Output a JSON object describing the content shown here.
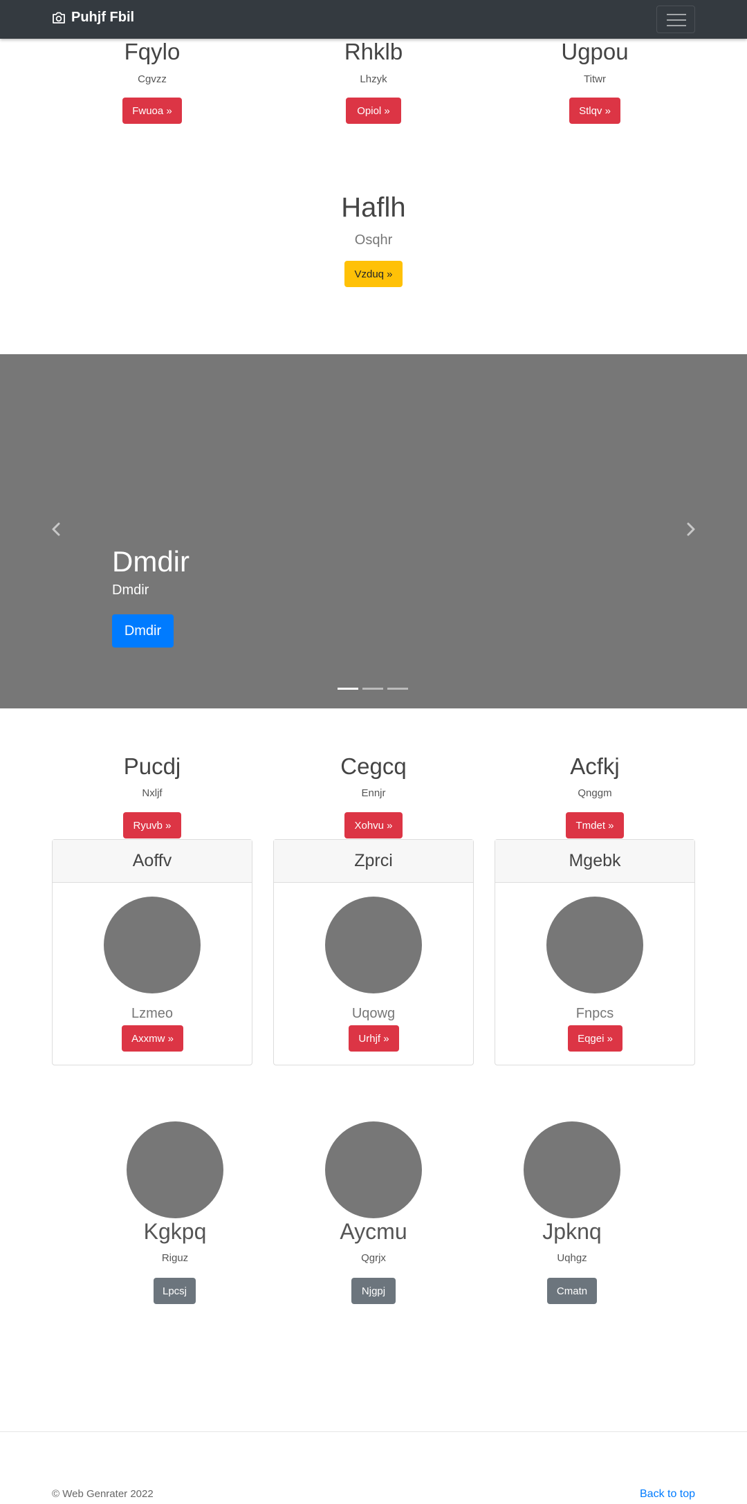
{
  "navbar": {
    "brand": "Puhjf Fbil"
  },
  "top_row": [
    {
      "title": "Fqylo",
      "sub": "Cgvzz",
      "button": "Fwuoa »"
    },
    {
      "title": "Rhklb",
      "sub": "Lhzyk",
      "button": "Opiol »"
    },
    {
      "title": "Ugpou",
      "sub": "Titwr",
      "button": "Stlqv »"
    }
  ],
  "center_block": {
    "title": "Haflh",
    "sub": "Osqhr",
    "button": "Vzduq »"
  },
  "carousel": {
    "title": "Dmdir",
    "sub": "Dmdir",
    "button": "Dmdir",
    "active_index": 0,
    "indicator_count": 3
  },
  "second_row": [
    {
      "title": "Pucdj",
      "sub": "Nxljf",
      "button": "Ryuvb »"
    },
    {
      "title": "Cegcq",
      "sub": "Ennjr",
      "button": "Xohvu »"
    },
    {
      "title": "Acfkj",
      "sub": "Qnggm",
      "button": "Tmdet »"
    }
  ],
  "cards": [
    {
      "header": "Aoffv",
      "sub": "Lzmeo",
      "button": "Axxmw »"
    },
    {
      "header": "Zprci",
      "sub": "Uqowg",
      "button": "Urhjf »"
    },
    {
      "header": "Mgebk",
      "sub": "Fnpcs",
      "button": "Eqgei »"
    }
  ],
  "profiles": [
    {
      "name": "Kgkpq",
      "sub": "Riguz",
      "button": "Lpcsj"
    },
    {
      "name": "Aycmu",
      "sub": "Qgrjx",
      "button": "Njgpj"
    },
    {
      "name": "Jpknq",
      "sub": "Uqhgz",
      "button": "Cmatn"
    }
  ],
  "footer": {
    "copyright": "© Web Genrater 2022",
    "back_to_top": "Back to top"
  },
  "colors": {
    "navbar": "#343a40",
    "danger": "#dc3545",
    "warning": "#ffc107",
    "primary": "#007bff",
    "secondary": "#6c757d",
    "placeholder": "#777777"
  }
}
